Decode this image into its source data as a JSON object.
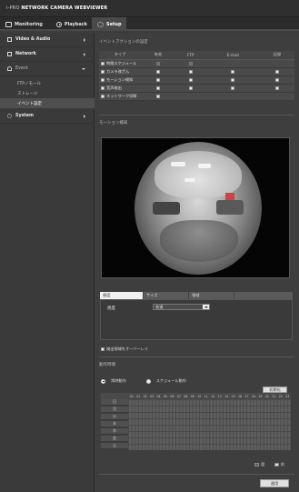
{
  "brand": {
    "prefix": "i-PRO",
    "title": "NETWORK CAMERA WEBVIEWER"
  },
  "nav": {
    "monitoring": "Monitoring",
    "playback": "Playback",
    "setup": "Setup"
  },
  "sidebar": {
    "items": [
      {
        "label": "Video & Audio",
        "icon": "camera-icon"
      },
      {
        "label": "Network",
        "icon": "network-icon"
      },
      {
        "label": "Event",
        "icon": "event-icon"
      },
      {
        "label": "System",
        "icon": "gear-icon"
      }
    ],
    "event_sub": [
      "FTPノモール",
      "ストレージ",
      "イベント設定"
    ]
  },
  "event_actions": {
    "section_title": "イベントアクションの設定",
    "columns": [
      "タイプ",
      "有効",
      "FTP",
      "E-mail",
      "記録"
    ],
    "rows": [
      {
        "label": "時間スケジュール"
      },
      {
        "label": "カメラ改ざん"
      },
      {
        "label": "モーション検知"
      },
      {
        "label": "音声検出"
      },
      {
        "label": "ネットワーク切断"
      }
    ]
  },
  "motion": {
    "section_title": "モーション検知"
  },
  "tabs": {
    "area": "感度",
    "size": "サイズ",
    "region": "領域"
  },
  "sensitivity": {
    "label": "感度",
    "value": "普通"
  },
  "overlay": {
    "label": "検出領域をオーバーレイ"
  },
  "schedule": {
    "section_title": "動作時間",
    "always": "常時動作",
    "scheduled": "スケジュール動作",
    "reset_button": "初期化",
    "days": [
      "日",
      "月",
      "火",
      "水",
      "木",
      "金",
      "土"
    ],
    "hours": [
      "00",
      "01",
      "02",
      "03",
      "04",
      "05",
      "06",
      "07",
      "08",
      "09",
      "10",
      "11",
      "12",
      "13",
      "14",
      "15",
      "16",
      "17",
      "18",
      "19",
      "20",
      "21",
      "22",
      "23"
    ],
    "legend_on": "選",
    "legend_off": "削"
  },
  "apply_button": "適用"
}
